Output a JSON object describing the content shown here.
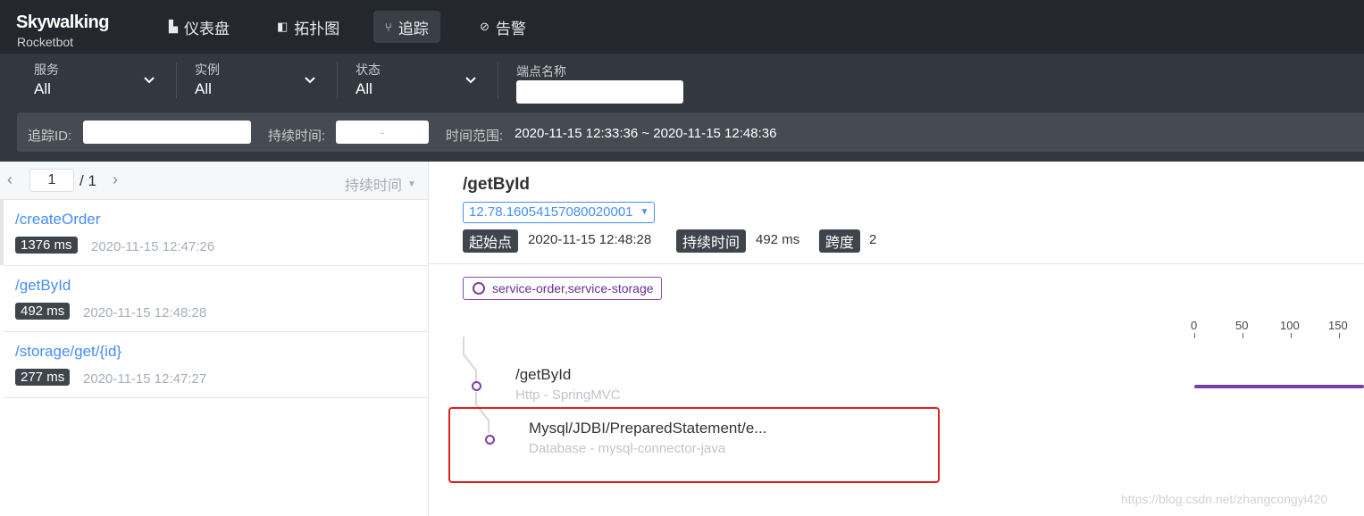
{
  "app": {
    "logo": "Skywalking",
    "logo_sub": "Rocketbot"
  },
  "nav": [
    {
      "label": "仪表盘",
      "icon": "dashboard-icon",
      "glyph": "▙"
    },
    {
      "label": "拓扑图",
      "icon": "topology-icon",
      "glyph": "◧"
    },
    {
      "label": "追踪",
      "icon": "trace-icon",
      "glyph": "⑂"
    },
    {
      "label": "告警",
      "icon": "alarm-icon",
      "glyph": "⊘"
    }
  ],
  "filters": {
    "service": {
      "label": "服务",
      "value": "All"
    },
    "instance": {
      "label": "实例",
      "value": "All"
    },
    "status": {
      "label": "状态",
      "value": "All"
    },
    "endpoint": {
      "label": "端点名称",
      "value": ""
    }
  },
  "subfilters": {
    "trace_id_label": "追踪ID:",
    "trace_id_value": "",
    "duration_label": "持续时间:",
    "duration_sep": "-",
    "time_range_label": "时间范围:",
    "time_range_value": "2020-11-15 12:33:36 ~ 2020-11-15 12:48:36"
  },
  "pager": {
    "prev": "‹",
    "page": "1",
    "total": "/ 1",
    "next": "›",
    "sort_label": "持续时间",
    "sort_arrow": "▼"
  },
  "traces": [
    {
      "endpoint": "/createOrder",
      "duration": "1376 ms",
      "time": "2020-11-15 12:47:26"
    },
    {
      "endpoint": "/getById",
      "duration": "492 ms",
      "time": "2020-11-15 12:48:28"
    },
    {
      "endpoint": "/storage/get/{id}",
      "duration": "277 ms",
      "time": "2020-11-15 12:47:27"
    }
  ],
  "detail": {
    "title": "/getById",
    "trace_id": "12.78.16054157080020001",
    "dropdown_arrow": "▼",
    "start_label": "起始点",
    "start_value": "2020-11-15 12:48:28",
    "duration_label": "持续时间",
    "duration_value": "492 ms",
    "span_label": "跨度",
    "span_value": "2",
    "services": "service-order,service-storage",
    "axis": [
      "0",
      "50",
      "100",
      "150"
    ],
    "spans": [
      {
        "name": "/getById",
        "sub": "Http - SpringMVC"
      },
      {
        "name": "Mysql/JDBI/PreparedStatement/e...",
        "sub": "Database - mysql-connector-java"
      }
    ]
  },
  "watermark": "https://blog.csdn.net/zhangcongyi420",
  "colors": {
    "accent": "#448dfe",
    "span": "#7a3fa7",
    "highlight": "#e02020",
    "nav_bg": "#24282e"
  }
}
